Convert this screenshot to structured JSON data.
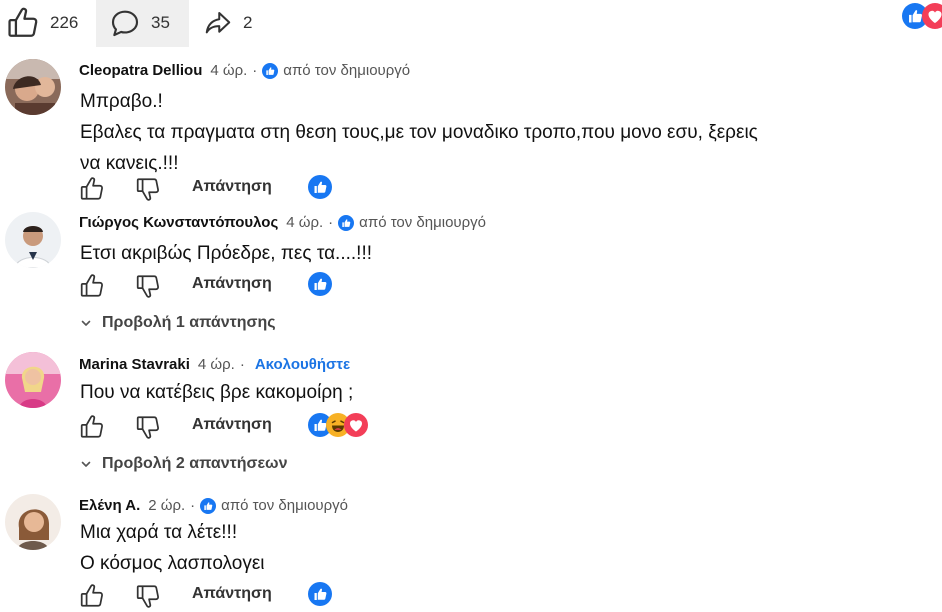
{
  "stats": {
    "likes": "226",
    "comments": "35",
    "shares": "2"
  },
  "colors": {
    "like_blue": "#1877f2",
    "love_red": "#f33e58",
    "haha_yellow": "#f7b125",
    "follow_blue": "#1b74e4"
  },
  "comments": [
    {
      "author": "Cleopatra Delliou",
      "time": "4 ώρ.",
      "badge": "από τον δημιουργό",
      "text": "Μπραβο.!\nΕβαλες τα πραγματα στη θεση τους,με τον μοναδικο τροπο,που μονο εσυ, ξερεις\nνα κανεις.!!!",
      "reply_label": "Απάντηση",
      "reactions": [
        "like-icon"
      ]
    },
    {
      "author": "Γιώργος Κωνσταντόπουλος",
      "time": "4 ώρ.",
      "badge": "από τον δημιουργό",
      "text": "Ετσι ακριβώς Πρόεδρε, πες τα....!!!",
      "reply_label": "Απάντηση",
      "reactions": [
        "like-icon"
      ],
      "view_replies": "Προβολή 1 απάντησης"
    },
    {
      "author": "Marina Stavraki",
      "time": "4 ώρ.",
      "follow": "Ακολουθήστε",
      "text": "Που να κατέβεις βρε κακομοίρη ;",
      "reply_label": "Απάντηση",
      "reactions": [
        "like-icon",
        "haha-icon",
        "love-icon"
      ],
      "view_replies": "Προβολή 2 απαντήσεων"
    },
    {
      "author": "Ελένη Α.",
      "time": "2 ώρ.",
      "badge": "από τον δημιουργό",
      "text": "Μια χαρά τα λέτε!!!\nΟ κόσμος λασπολογει",
      "reply_label": "Απάντηση",
      "reactions": [
        "like-icon"
      ]
    }
  ]
}
